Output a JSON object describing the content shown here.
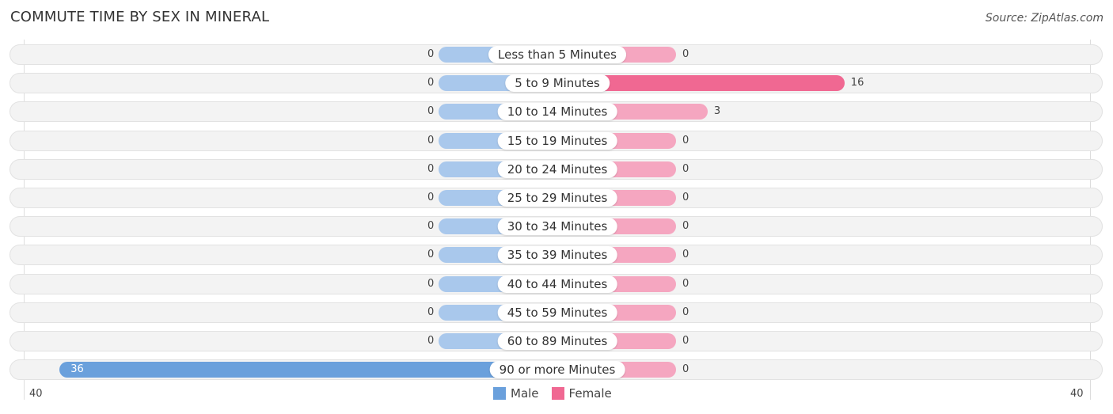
{
  "title": "COMMUTE TIME BY SEX IN MINERAL",
  "source": "Source: ZipAtlas.com",
  "colors": {
    "male": "#6aa0dc",
    "male_light": "#a9c8ec",
    "female": "#f06892",
    "female_light": "#f5a6c0"
  },
  "chart_data": {
    "type": "bar",
    "title": "COMMUTE TIME BY SEX IN MINERAL",
    "categories": [
      "Less than 5 Minutes",
      "5 to 9 Minutes",
      "10 to 14 Minutes",
      "15 to 19 Minutes",
      "20 to 24 Minutes",
      "25 to 29 Minutes",
      "30 to 34 Minutes",
      "35 to 39 Minutes",
      "40 to 44 Minutes",
      "45 to 59 Minutes",
      "60 to 89 Minutes",
      "90 or more Minutes"
    ],
    "series": [
      {
        "name": "Male",
        "values": [
          0,
          0,
          0,
          0,
          0,
          0,
          0,
          0,
          0,
          0,
          0,
          36
        ]
      },
      {
        "name": "Female",
        "values": [
          0,
          16,
          3,
          0,
          0,
          0,
          0,
          0,
          0,
          0,
          0,
          0
        ]
      }
    ],
    "xlim": [
      40,
      40
    ],
    "axis_left_label": "40",
    "axis_right_label": "40",
    "legend": [
      "Male",
      "Female"
    ],
    "legend_position": "bottom-center"
  }
}
